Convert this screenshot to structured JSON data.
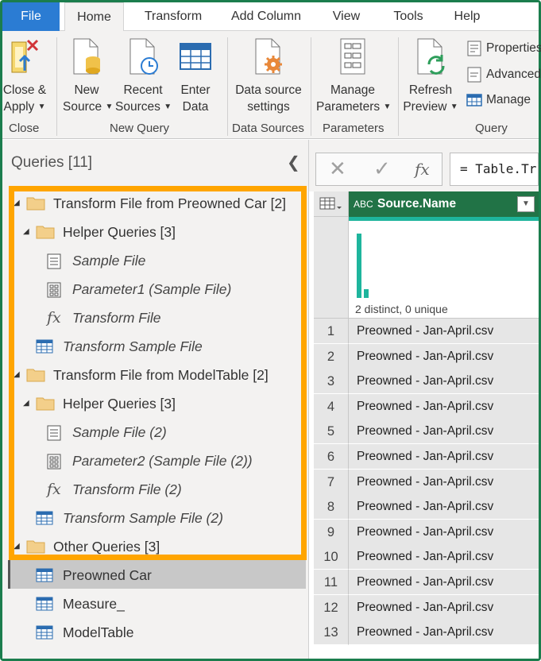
{
  "tabs": [
    "File",
    "Home",
    "Transform",
    "Add Column",
    "View",
    "Tools",
    "Help"
  ],
  "active_tab": "Home",
  "ribbon": {
    "close_apply": [
      "Close &",
      "Apply"
    ],
    "new_source": [
      "New",
      "Source"
    ],
    "recent_sources": [
      "Recent",
      "Sources"
    ],
    "enter_data": [
      "Enter",
      "Data"
    ],
    "data_source_settings": [
      "Data source",
      "settings"
    ],
    "manage_parameters": [
      "Manage",
      "Parameters"
    ],
    "refresh_preview": [
      "Refresh",
      "Preview"
    ],
    "properties": "Properties",
    "advanced_editor": "Advanced",
    "manage": "Manage",
    "groups": {
      "close": "Close",
      "new_query": "New Query",
      "data_sources": "Data Sources",
      "parameters": "Parameters",
      "query": "Query"
    }
  },
  "queries": {
    "title": "Queries [11]",
    "items": [
      "Transform File from Preowned Car [2]",
      "Helper Queries [3]",
      "Sample File",
      "Parameter1 (Sample File)",
      "Transform File",
      "Transform Sample File",
      "Transform File from ModelTable [2]",
      "Helper Queries [3]",
      "Sample File (2)",
      "Parameter2 (Sample File (2))",
      "Transform File (2)",
      "Transform Sample File (2)",
      "Other Queries [3]",
      "Preowned Car",
      "Measure_",
      "ModelTable"
    ]
  },
  "formula_bar": {
    "cancel": "✕",
    "commit": "✓",
    "fx": "fx",
    "formula": "= Table.Tr"
  },
  "grid": {
    "column_type": "ABC",
    "column_name": "Source.Name",
    "profile_text": "2 distinct, 0 unique",
    "distribution": [
      0.92,
      0.12
    ],
    "row_numbers": [
      "1",
      "2",
      "3",
      "4",
      "5",
      "6",
      "7",
      "8",
      "9",
      "10",
      "11",
      "12",
      "13"
    ],
    "rows": [
      "Preowned - Jan-April.csv",
      "Preowned - Jan-April.csv",
      "Preowned - Jan-April.csv",
      "Preowned - Jan-April.csv",
      "Preowned - Jan-April.csv",
      "Preowned - Jan-April.csv",
      "Preowned - Jan-April.csv",
      "Preowned - Jan-April.csv",
      "Preowned - Jan-April.csv",
      "Preowned - Jan-April.csv",
      "Preowned - Jan-April.csv",
      "Preowned - Jan-April.csv",
      "Preowned - Jan-April.csv"
    ]
  },
  "colors": {
    "accent_green": "#217346",
    "file_tab": "#2b7cd3",
    "highlight": "#ffa500",
    "quality": "#1eb59d"
  }
}
